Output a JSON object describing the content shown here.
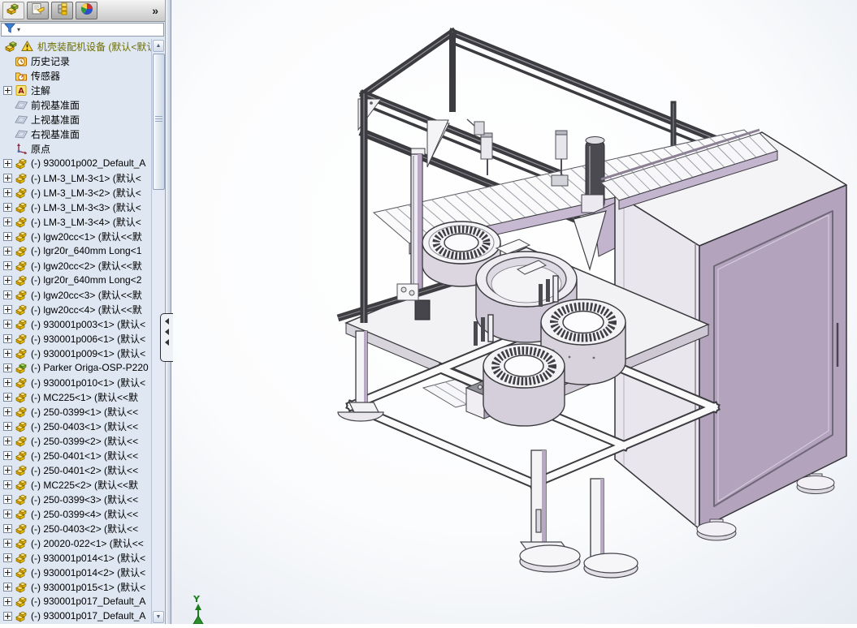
{
  "app": {
    "name": "SolidWorks FeatureManager",
    "tabs": [
      {
        "name": "featuremanager-tree",
        "icon": "assembly",
        "active": true
      },
      {
        "name": "propertymanager",
        "icon": "property-form",
        "active": false
      },
      {
        "name": "configurationmanager",
        "icon": "configurations",
        "active": false
      },
      {
        "name": "displaymanager",
        "icon": "appearance-sphere",
        "active": false
      }
    ],
    "more_label": "»",
    "filter": {
      "icon": "filter-funnel",
      "dropdown": "▾",
      "value": ""
    }
  },
  "tree": {
    "root": {
      "label": "机壳装配机设备 (默认<默认",
      "icon": "assembly",
      "warning": true,
      "color": "#6e6e00"
    },
    "items": [
      {
        "label": "历史记录",
        "icon": "history",
        "expandable": false
      },
      {
        "label": "传感器",
        "icon": "sensors",
        "expandable": false
      },
      {
        "label": "注解",
        "icon": "annotations",
        "expandable": true
      },
      {
        "label": "前视基准面",
        "icon": "plane",
        "expandable": false
      },
      {
        "label": "上视基准面",
        "icon": "plane",
        "expandable": false
      },
      {
        "label": "右视基准面",
        "icon": "plane",
        "expandable": false
      },
      {
        "label": "原点",
        "icon": "origin",
        "expandable": false
      },
      {
        "label": "(-) 930001p002_Default_A",
        "icon": "component",
        "expandable": true
      },
      {
        "label": "(-) LM-3_LM-3<1> (默认<",
        "icon": "component",
        "expandable": true
      },
      {
        "label": "(-) LM-3_LM-3<2> (默认<",
        "icon": "component",
        "expandable": true
      },
      {
        "label": "(-) LM-3_LM-3<3> (默认<",
        "icon": "component",
        "expandable": true
      },
      {
        "label": "(-) LM-3_LM-3<4> (默认<",
        "icon": "component",
        "expandable": true
      },
      {
        "label": "(-) lgw20cc<1> (默认<<默",
        "icon": "component",
        "expandable": true
      },
      {
        "label": "(-) lgr20r_640mm Long<1",
        "icon": "component",
        "expandable": true
      },
      {
        "label": "(-) lgw20cc<2> (默认<<默",
        "icon": "component",
        "expandable": true
      },
      {
        "label": "(-) lgr20r_640mm Long<2",
        "icon": "component",
        "expandable": true
      },
      {
        "label": "(-) lgw20cc<3> (默认<<默",
        "icon": "component",
        "expandable": true
      },
      {
        "label": "(-) lgw20cc<4> (默认<<默",
        "icon": "component",
        "expandable": true
      },
      {
        "label": "(-) 930001p003<1> (默认<",
        "icon": "component",
        "expandable": true
      },
      {
        "label": "(-) 930001p006<1> (默认<",
        "icon": "component",
        "expandable": true
      },
      {
        "label": "(-) 930001p009<1> (默认<",
        "icon": "component",
        "expandable": true
      },
      {
        "label": "(-) Parker Origa-OSP-P220",
        "icon": "subassembly",
        "expandable": true
      },
      {
        "label": "(-) 930001p010<1> (默认<",
        "icon": "component",
        "expandable": true
      },
      {
        "label": "(-) MC225<1> (默认<<默",
        "icon": "component",
        "expandable": true
      },
      {
        "label": "(-) 250-0399<1> (默认<<",
        "icon": "component",
        "expandable": true
      },
      {
        "label": "(-) 250-0403<1> (默认<<",
        "icon": "component",
        "expandable": true
      },
      {
        "label": "(-) 250-0399<2> (默认<<",
        "icon": "component",
        "expandable": true
      },
      {
        "label": "(-) 250-0401<1> (默认<<",
        "icon": "component",
        "expandable": true
      },
      {
        "label": "(-) 250-0401<2> (默认<<",
        "icon": "component",
        "expandable": true
      },
      {
        "label": "(-) MC225<2> (默认<<默",
        "icon": "component",
        "expandable": true
      },
      {
        "label": "(-) 250-0399<3> (默认<<",
        "icon": "component",
        "expandable": true
      },
      {
        "label": "(-) 250-0399<4> (默认<<",
        "icon": "component",
        "expandable": true
      },
      {
        "label": "(-) 250-0403<2> (默认<<",
        "icon": "component",
        "expandable": true
      },
      {
        "label": "(-) 20020-022<1> (默认<<",
        "icon": "component",
        "expandable": true
      },
      {
        "label": "(-) 930001p014<1> (默认<",
        "icon": "component",
        "expandable": true
      },
      {
        "label": "(-) 930001p014<2> (默认<",
        "icon": "component",
        "expandable": true
      },
      {
        "label": "(-) 930001p015<1> (默认<",
        "icon": "component",
        "expandable": true
      },
      {
        "label": "(-) 930001p017_Default_A",
        "icon": "component",
        "expandable": true
      },
      {
        "label": "(-) 930001p017_Default_A",
        "icon": "component",
        "expandable": true
      }
    ]
  },
  "viewport": {
    "triad_axis_label": "Y",
    "colors": {
      "cabinet_lavender": "#b4a3bd",
      "light_lavender": "#c7b9d1",
      "frame_dark": "#3b3b40",
      "triad_green": "#1e7d1e",
      "background_edge": "#e7ebf3"
    }
  }
}
